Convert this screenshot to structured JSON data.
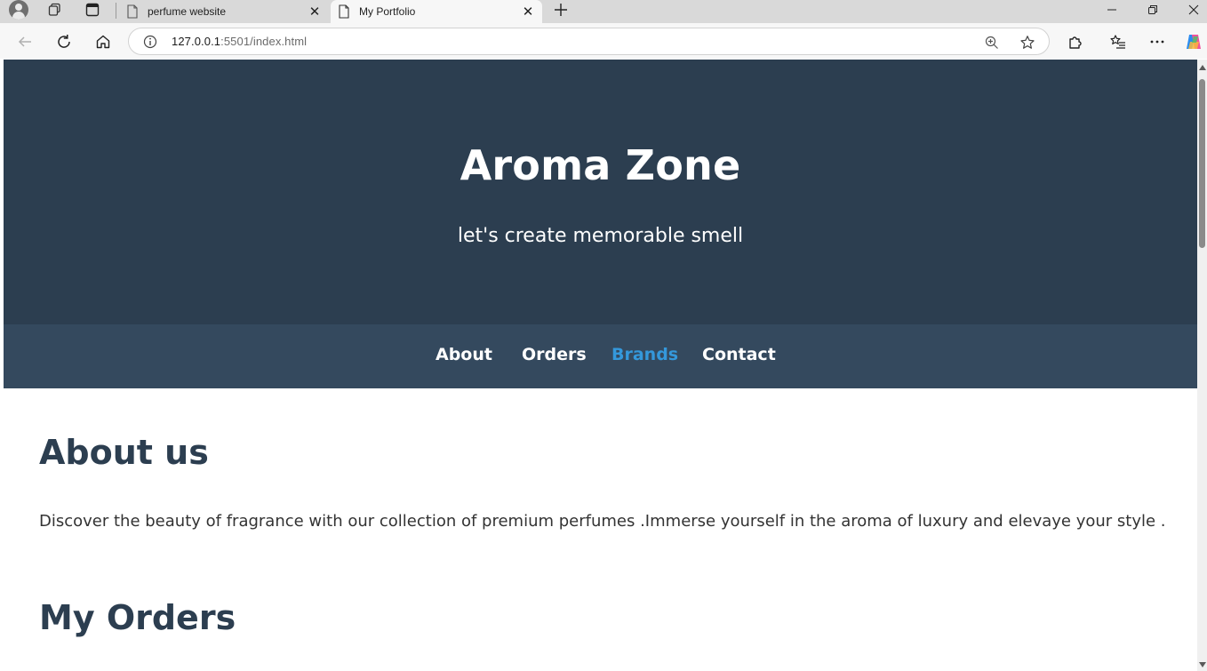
{
  "browser": {
    "tabs": [
      {
        "title": "perfume website",
        "active": false
      },
      {
        "title": "My Portfolio",
        "active": true
      }
    ],
    "address": {
      "host": "127.0.0.1",
      "rest": ":5501/index.html"
    },
    "icons": {
      "profile": "profile-avatar-icon",
      "workspaces": "workspaces-icon",
      "tab_actions": "vertical-tabs-icon",
      "new_tab": "plus-icon",
      "back": "back-arrow-icon",
      "refresh": "refresh-icon",
      "home": "home-icon",
      "site_info": "info-icon",
      "zoom": "zoom-icon",
      "favorite": "star-icon",
      "extensions": "puzzle-icon",
      "favorites": "favorites-icon",
      "menu": "more-icon",
      "copilot": "copilot-icon"
    }
  },
  "site": {
    "title": "Aroma Zone",
    "tagline": "let's create memorable smell",
    "nav": [
      {
        "label": "About",
        "active": false
      },
      {
        "label": "Orders",
        "active": false
      },
      {
        "label": "Brands",
        "active": true
      },
      {
        "label": "Contact",
        "active": false
      }
    ],
    "about": {
      "heading": "About us",
      "text": "Discover the beauty of fragrance with our collection of premium perfumes .Immerse yourself in the aroma of luxury and elevaye your style ."
    },
    "orders": {
      "heading": "My Orders"
    }
  },
  "colors": {
    "hero_bg": "#2c3e50",
    "nav_bg": "#34495e",
    "nav_active": "#3498db",
    "heading": "#2c3e50",
    "body_text": "#333333"
  }
}
